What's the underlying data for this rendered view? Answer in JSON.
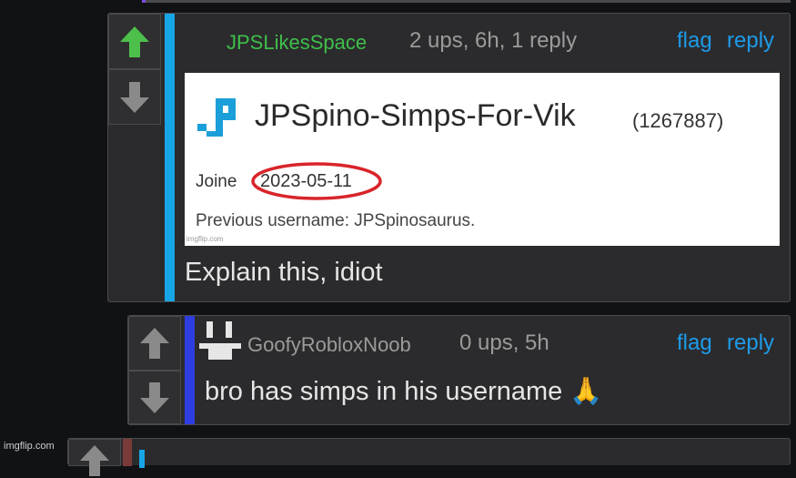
{
  "comments": [
    {
      "username": "JPSLikesSpace",
      "meta": "2 ups, 6h, 1 reply",
      "flag": "flag",
      "reply": "reply",
      "text": "Explain this, idiot",
      "username_color": "#3fbf4a",
      "stripe_color": "#16a6e6"
    },
    {
      "username": "GoofyRobloxNoob",
      "meta": "0 ups, 5h",
      "flag": "flag",
      "reply": "reply",
      "text": "bro has simps in his username",
      "emoji": "🙏",
      "stripe_color": "#2d3de0"
    }
  ],
  "embedded_image": {
    "profile_name": "JPSpino-Simps-For-Vik",
    "user_id": "(1267887)",
    "joined_label": "Joine",
    "joined_date": "2023-05-11",
    "previous_username": "Previous username: JPSpinosaurus.",
    "watermark": "imgflip.com"
  },
  "page_watermark": "imgflip.com",
  "icons": {
    "upvote": "arrow-up-icon",
    "downvote": "arrow-down-icon",
    "logo": "imgflip-logo-icon",
    "avatar": "robot-avatar-icon"
  },
  "colors": {
    "upvote_active": "#4cc04a",
    "vote_inactive": "#8a8a8a",
    "link": "#1e9be8",
    "circle": "#d9242b"
  }
}
